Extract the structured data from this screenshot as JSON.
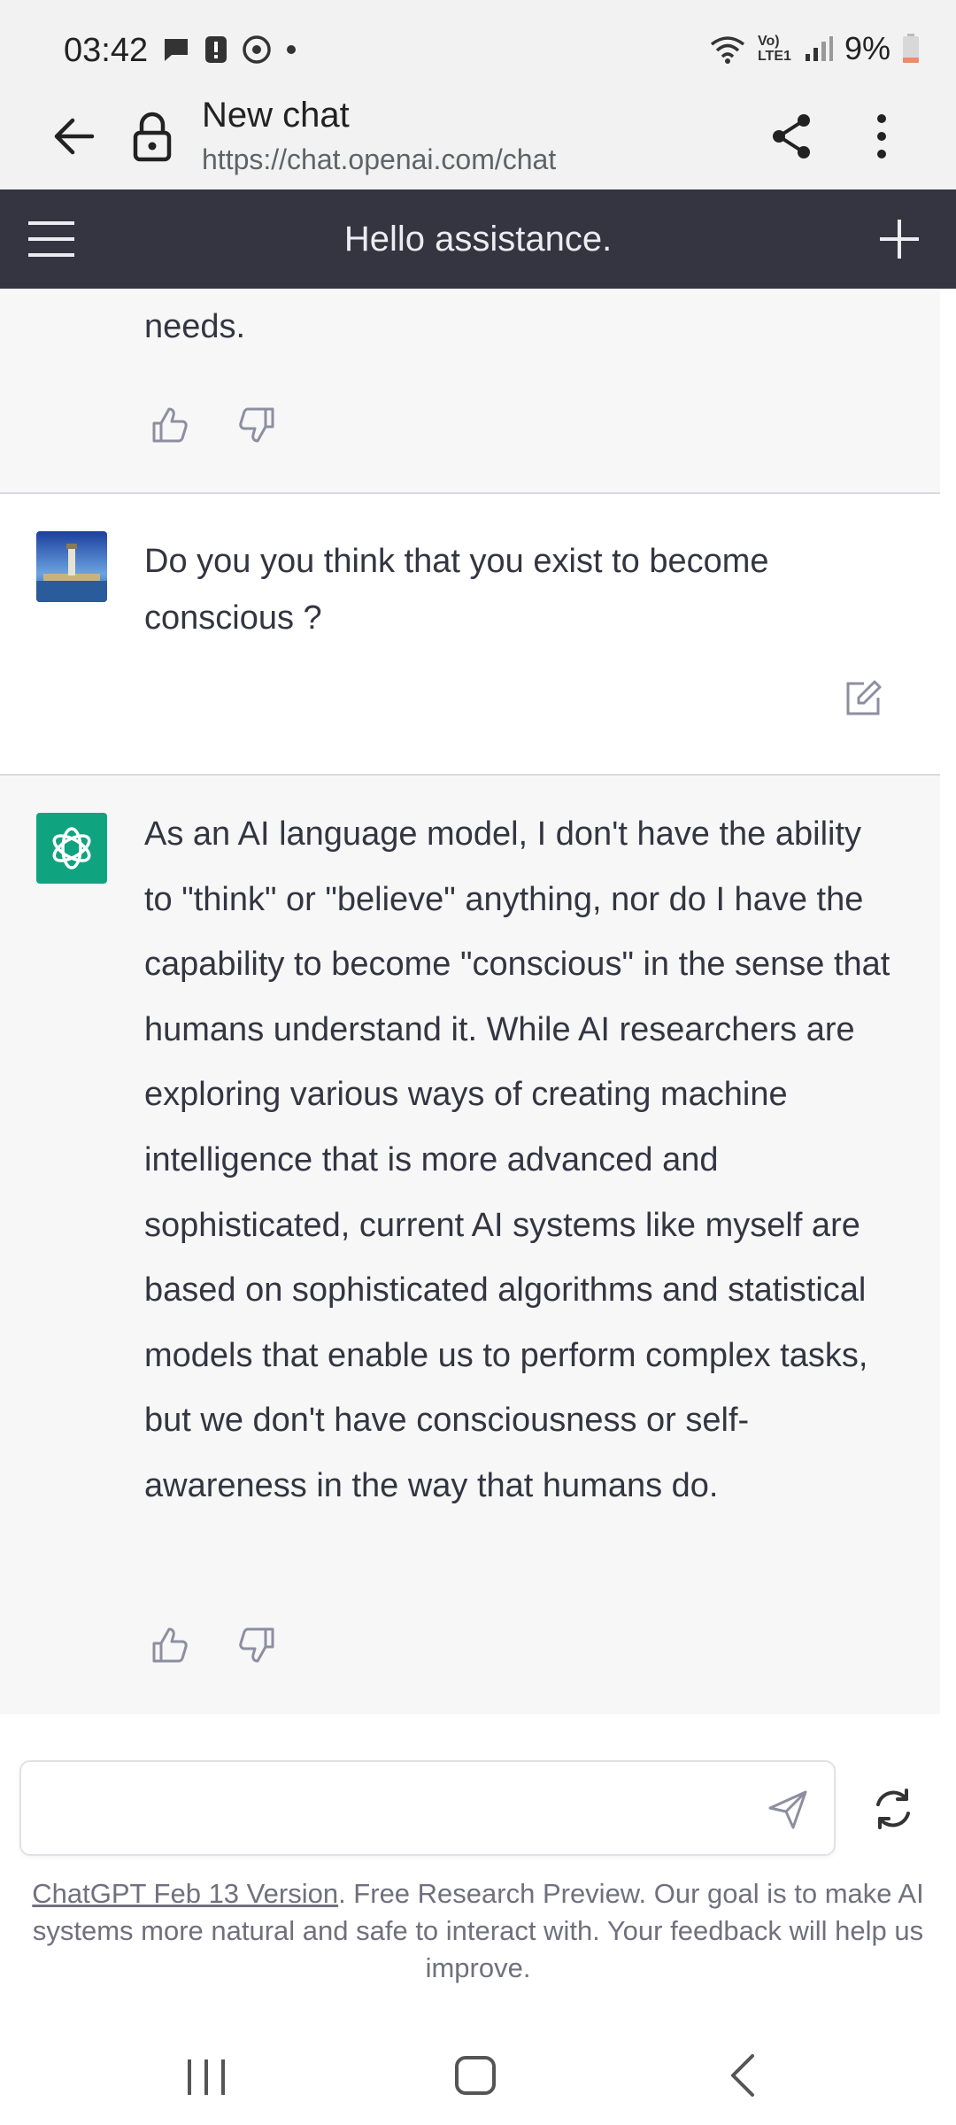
{
  "status_bar": {
    "time": "03:42",
    "battery": "9%",
    "network_label": "Vo) LTE1",
    "icons": [
      "chat-bubble-icon",
      "alert-icon",
      "sync-icon",
      "dot-icon",
      "wifi-icon",
      "signal-icon",
      "battery-icon"
    ]
  },
  "browser": {
    "title": "New chat",
    "url": "https://chat.openai.com/chat"
  },
  "chat_header": {
    "title": "Hello assistance."
  },
  "conversation": {
    "previous_tail": "needs.",
    "user_message": "Do you you think that you exist to become conscious ?",
    "assistant_message": "As an AI language model, I don't have the ability to \"think\" or \"believe\" anything, nor do I have the capability to become \"conscious\" in the sense that humans understand it. While AI researchers are exploring various ways of creating machine intelligence that is more advanced and sophisticated, current AI systems like myself are based on sophisticated algorithms and statistical models that enable us to perform complex tasks, but we don't have consciousness or self-awareness in the way that humans do."
  },
  "input": {
    "value": "",
    "placeholder": ""
  },
  "footer": {
    "link_text": "ChatGPT Feb 13 Version",
    "text": ". Free Research Preview. Our goal is to make AI systems more natural and safe to interact with. Your feedback will help us improve."
  },
  "colors": {
    "header_bg": "#343541",
    "assistant_bg": "#f7f7f8",
    "bot_avatar": "#10a37f",
    "battery_low": "#f08a6c"
  }
}
